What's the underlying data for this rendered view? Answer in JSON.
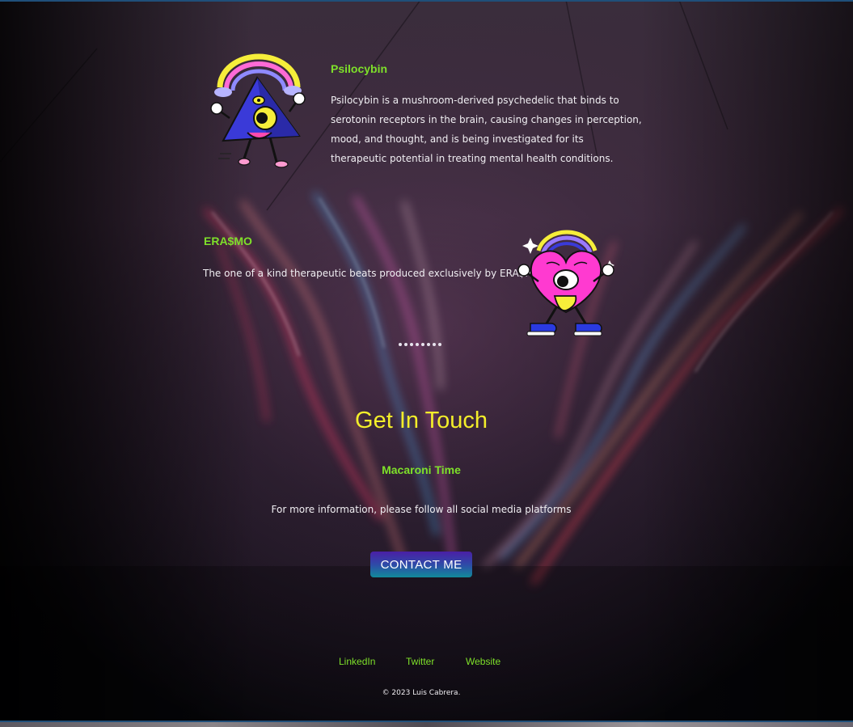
{
  "cards": [
    {
      "title": "Psilocybin",
      "text": "Psilocybin is a mushroom-derived psychedelic that binds to serotonin receptors in the brain, causing changes in perception, mood, and thought, and is being investigated for its therapeutic potential in treating mental health conditions."
    },
    {
      "title": "ERA$MO",
      "text": "The one of a kind therapeutic beats produced exclusively by ERA$MO"
    }
  ],
  "slider": {
    "dot_count": 8
  },
  "contact": {
    "heading": "Get In Touch",
    "subheading": "Macaroni Time",
    "text": "For more information, please follow all social media platforms",
    "button_label": "CONTACT ME"
  },
  "footer": {
    "links": [
      "LinkedIn",
      "Twitter",
      "Website"
    ],
    "copyright": "© 2023 Luis Cabrera."
  },
  "colors": {
    "accent_green": "#7ee02a",
    "heading_yellow": "#f3ee2a",
    "button_gradient": [
      "#4a1fa6",
      "#2f4aa8",
      "#118a9a"
    ]
  },
  "icons": {
    "card_1": "pyramid-eye-rainbow-character-icon",
    "card_2": "heart-eye-rainbow-character-icon"
  }
}
